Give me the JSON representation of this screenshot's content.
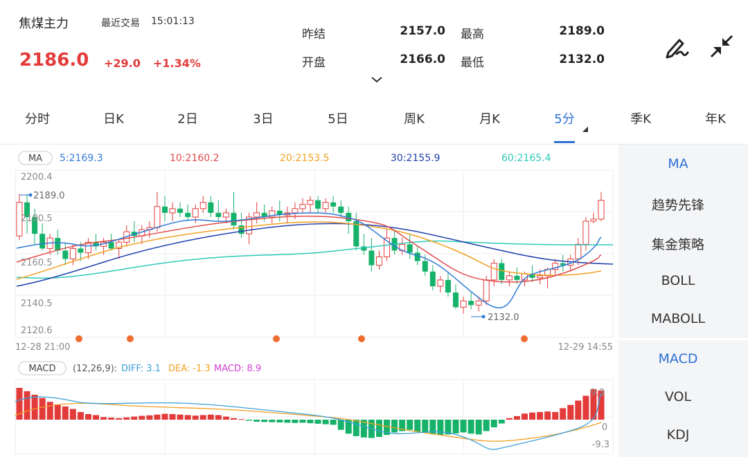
{
  "header": {
    "title": "焦煤主力",
    "recent_label": "最近交易",
    "time": "15:01:13",
    "price": "2186.0",
    "change": "+29.0",
    "change_pct": "+1.34%",
    "stats": [
      {
        "label": "昨结",
        "value": "2157.0"
      },
      {
        "label": "最高",
        "value": "2189.0"
      },
      {
        "label": "开盘",
        "value": "2166.0"
      },
      {
        "label": "最低",
        "value": "2132.0"
      }
    ],
    "icons": [
      "chevron-down-icon",
      "pen-draw-icon",
      "collapse-arrows-icon"
    ],
    "up_color": "#e33a3a",
    "down_color": "#17b26a"
  },
  "tabs": [
    "分时",
    "日K",
    "2日",
    "3日",
    "5日",
    "周K",
    "月K",
    "5分",
    "季K",
    "年K"
  ],
  "active_tab": "5分",
  "ma_legend": {
    "tag": "MA",
    "items": [
      {
        "text": "5:2169.3",
        "color": "#2d7bd6"
      },
      {
        "text": "10:2160.2",
        "color": "#e04a4a"
      },
      {
        "text": "20:2153.5",
        "color": "#f0a020"
      },
      {
        "text": "30:2155.9",
        "color": "#1f3fae"
      },
      {
        "text": "60:2165.4",
        "color": "#2ec9b8"
      }
    ]
  },
  "y_ticks": [
    "2200.4",
    "2180.5",
    "2160.5",
    "2140.5",
    "2120.6"
  ],
  "time_start": "12-28 21:00",
  "time_end": "12-29 14:55",
  "high_marker": "2189.0",
  "low_marker": "2132.0",
  "macd_legend": {
    "tag": "MACD",
    "params": "(12,26,9):",
    "diff": "DIFF: 3.1",
    "dea": "DEA: -1.3",
    "macd": "MACD: 8.9",
    "diff_color": "#3aa0d8",
    "dea_color": "#f0a020",
    "macd_color": "#d040d0"
  },
  "macd_ticks": [
    "9.3",
    "0",
    "-9.3"
  ],
  "right_panel": {
    "main_items": [
      "MA",
      "趋势先锋",
      "集金策略",
      "BOLL",
      "MABOLL"
    ],
    "sub_items": [
      "MACD",
      "VOL",
      "KDJ"
    ],
    "active_main": "MA",
    "active_sub": "MACD"
  },
  "chart_data": {
    "type": "candlestick",
    "ylim": [
      2120.6,
      2200.4
    ],
    "candles": [
      [
        2169,
        2189,
        2167,
        2185
      ],
      [
        2185,
        2189,
        2170,
        2178
      ],
      [
        2178,
        2182,
        2165,
        2170
      ],
      [
        2170,
        2175,
        2162,
        2163
      ],
      [
        2163,
        2170,
        2160,
        2168
      ],
      [
        2168,
        2172,
        2160,
        2162
      ],
      [
        2162,
        2166,
        2155,
        2158
      ],
      [
        2158,
        2165,
        2155,
        2163
      ],
      [
        2163,
        2166,
        2157,
        2161
      ],
      [
        2161,
        2168,
        2158,
        2166
      ],
      [
        2166,
        2170,
        2162,
        2164
      ],
      [
        2164,
        2168,
        2160,
        2166
      ],
      [
        2166,
        2170,
        2162,
        2163
      ],
      [
        2163,
        2167,
        2158,
        2166
      ],
      [
        2166,
        2174,
        2164,
        2171
      ],
      [
        2171,
        2176,
        2166,
        2169
      ],
      [
        2169,
        2174,
        2165,
        2172
      ],
      [
        2172,
        2176,
        2168,
        2173
      ],
      [
        2173,
        2190,
        2171,
        2183
      ],
      [
        2183,
        2188,
        2176,
        2180
      ],
      [
        2180,
        2185,
        2176,
        2182
      ],
      [
        2182,
        2185,
        2178,
        2180
      ],
      [
        2180,
        2184,
        2176,
        2178
      ],
      [
        2178,
        2184,
        2175,
        2182
      ],
      [
        2182,
        2188,
        2180,
        2185
      ],
      [
        2185,
        2188,
        2178,
        2180
      ],
      [
        2180,
        2186,
        2176,
        2178
      ],
      [
        2178,
        2182,
        2175,
        2180
      ],
      [
        2180,
        2190,
        2172,
        2174
      ],
      [
        2174,
        2180,
        2168,
        2170
      ],
      [
        2170,
        2180,
        2165,
        2178
      ],
      [
        2178,
        2185,
        2175,
        2180
      ],
      [
        2180,
        2184,
        2176,
        2178
      ],
      [
        2178,
        2183,
        2175,
        2181
      ],
      [
        2181,
        2186,
        2176,
        2179
      ],
      [
        2179,
        2183,
        2175,
        2180
      ],
      [
        2180,
        2185,
        2177,
        2182
      ],
      [
        2182,
        2187,
        2180,
        2184
      ],
      [
        2184,
        2188,
        2180,
        2186
      ],
      [
        2186,
        2188,
        2180,
        2182
      ],
      [
        2182,
        2187,
        2180,
        2185
      ],
      [
        2185,
        2188,
        2180,
        2183
      ],
      [
        2183,
        2186,
        2178,
        2180
      ],
      [
        2180,
        2183,
        2170,
        2176
      ],
      [
        2176,
        2180,
        2162,
        2164
      ],
      [
        2164,
        2170,
        2160,
        2162
      ],
      [
        2162,
        2168,
        2152,
        2155
      ],
      [
        2155,
        2162,
        2153,
        2159
      ],
      [
        2159,
        2172,
        2157,
        2168
      ],
      [
        2168,
        2172,
        2160,
        2162
      ],
      [
        2162,
        2168,
        2160,
        2165
      ],
      [
        2165,
        2170,
        2158,
        2161
      ],
      [
        2161,
        2164,
        2155,
        2157
      ],
      [
        2157,
        2160,
        2150,
        2152
      ],
      [
        2152,
        2155,
        2143,
        2145
      ],
      [
        2145,
        2150,
        2142,
        2148
      ],
      [
        2148,
        2152,
        2140,
        2142
      ],
      [
        2142,
        2146,
        2134,
        2135
      ],
      [
        2135,
        2140,
        2132,
        2138
      ],
      [
        2138,
        2142,
        2134,
        2136
      ],
      [
        2136,
        2140,
        2133,
        2138
      ],
      [
        2138,
        2150,
        2136,
        2148
      ],
      [
        2148,
        2158,
        2145,
        2156
      ],
      [
        2156,
        2158,
        2146,
        2148
      ],
      [
        2148,
        2152,
        2145,
        2150
      ],
      [
        2150,
        2154,
        2146,
        2148
      ],
      [
        2148,
        2152,
        2145,
        2151
      ],
      [
        2151,
        2155,
        2147,
        2149
      ],
      [
        2149,
        2153,
        2146,
        2150
      ],
      [
        2150,
        2154,
        2144,
        2153
      ],
      [
        2153,
        2158,
        2150,
        2156
      ],
      [
        2156,
        2160,
        2152,
        2155
      ],
      [
        2155,
        2160,
        2152,
        2158
      ],
      [
        2158,
        2168,
        2155,
        2165
      ],
      [
        2165,
        2178,
        2162,
        2176
      ],
      [
        2176,
        2180,
        2175,
        2177
      ],
      [
        2177,
        2190,
        2176,
        2186
      ]
    ],
    "macd_bars": [
      12.5,
      11.2,
      9.8,
      8.5,
      7.0,
      6.0,
      5.2,
      4.2,
      3.0,
      2.2,
      1.8,
      1.0,
      0.8,
      0.6,
      0.9,
      1.2,
      1.5,
      1.7,
      2.0,
      2.3,
      2.2,
      2.0,
      1.8,
      1.6,
      1.8,
      2.0,
      1.8,
      1.2,
      0.6,
      0.2,
      -0.4,
      -0.8,
      -0.9,
      -1.0,
      -1.1,
      -1.2,
      -1.3,
      -1.2,
      -1.4,
      -1.6,
      -1.8,
      -2.0,
      -4.0,
      -5.5,
      -6.5,
      -7.0,
      -7.2,
      -6.8,
      -6.0,
      -5.0,
      -4.5,
      -4.0,
      -4.8,
      -5.2,
      -5.6,
      -6.0,
      -5.8,
      -5.4,
      -5.0,
      -5.5,
      -5.8,
      -4.5,
      -3.0,
      -1.5,
      0.6,
      1.4,
      2.4,
      2.8,
      3.0,
      3.2,
      3.0,
      4.5,
      5.8,
      7.5,
      9.4,
      12.0,
      11.5
    ]
  }
}
